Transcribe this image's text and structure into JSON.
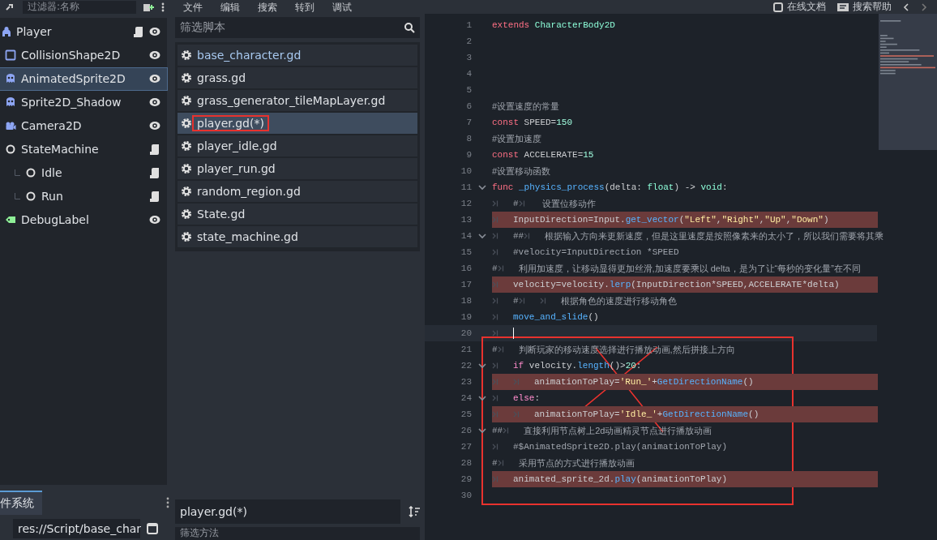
{
  "top_bar": {
    "node_filter_placeholder": "过滤器:名称",
    "menus": [
      "文件",
      "编辑",
      "搜索",
      "转到",
      "调试"
    ],
    "help_buttons": [
      "在线文档",
      "搜索帮助"
    ]
  },
  "scene_tree": {
    "items": [
      {
        "label": "Player",
        "kind": "body",
        "selected": false,
        "has_script": true,
        "has_visibility": true,
        "children": [
          {
            "label": "CollisionShape2D",
            "kind": "shape",
            "selected": false,
            "has_script": false,
            "has_visibility": true
          },
          {
            "label": "AnimatedSprite2D",
            "kind": "sprite",
            "selected": true,
            "has_script": false,
            "has_visibility": true
          },
          {
            "label": "Sprite2D_Shadow",
            "kind": "sprite",
            "selected": false,
            "has_script": false,
            "has_visibility": true
          },
          {
            "label": "Camera2D",
            "kind": "camera",
            "selected": false,
            "has_script": false,
            "has_visibility": true
          },
          {
            "label": "StateMachine",
            "kind": "node",
            "selected": false,
            "has_script": true,
            "has_visibility": false,
            "children": [
              {
                "label": "Idle",
                "kind": "node",
                "selected": false,
                "has_script": true,
                "has_visibility": false
              },
              {
                "label": "Run",
                "kind": "node",
                "selected": false,
                "has_script": true,
                "has_visibility": false
              }
            ]
          },
          {
            "label": "DebugLabel",
            "kind": "label",
            "selected": false,
            "has_script": false,
            "has_visibility": true
          }
        ]
      }
    ]
  },
  "filesystem": {
    "tab": "件系统",
    "path": "res://Script/base_char"
  },
  "script_panel": {
    "filter_placeholder": "筛选脚本",
    "scripts": [
      {
        "name": "base_character.gd",
        "selected": false,
        "outlined": false,
        "color": "#a8c9f0"
      },
      {
        "name": "grass.gd",
        "selected": false,
        "outlined": false,
        "color": "#dfe2e6"
      },
      {
        "name": "grass_generator_tileMapLayer.gd",
        "selected": false,
        "outlined": false,
        "color": "#dfe2e6"
      },
      {
        "name": "player.gd(*)",
        "selected": true,
        "outlined": true,
        "color": "#dfe2e6"
      },
      {
        "name": "player_idle.gd",
        "selected": false,
        "outlined": false,
        "color": "#dfe2e6"
      },
      {
        "name": "player_run.gd",
        "selected": false,
        "outlined": false,
        "color": "#dfe2e6"
      },
      {
        "name": "random_region.gd",
        "selected": false,
        "outlined": false,
        "color": "#dfe2e6"
      },
      {
        "name": "State.gd",
        "selected": false,
        "outlined": false,
        "color": "#dfe2e6"
      },
      {
        "name": "state_machine.gd",
        "selected": false,
        "outlined": false,
        "color": "#dfe2e6"
      }
    ],
    "current_script": "player.gd(*)",
    "method_filter_placeholder": "筛选方法"
  },
  "editor": {
    "lines": [
      {
        "number": "1",
        "tokens": [
          {
            "kind": "keyword",
            "text": "extends "
          },
          {
            "kind": "type",
            "text": "CharacterBody2D"
          }
        ],
        "highlighted": false,
        "foldable": false,
        "current": false
      },
      {
        "number": "2",
        "highlighted": false,
        "foldable": false,
        "current": false
      },
      {
        "number": "3",
        "highlighted": false,
        "foldable": false,
        "current": false
      },
      {
        "number": "4",
        "highlighted": false,
        "foldable": false,
        "current": false
      },
      {
        "number": "5",
        "highlighted": false,
        "foldable": false,
        "current": false
      },
      {
        "number": "6",
        "tokens": [
          {
            "kind": "comment",
            "text": "#设置速度的常量"
          }
        ],
        "highlighted": false,
        "foldable": false,
        "current": false
      },
      {
        "number": "7",
        "tokens": [
          {
            "kind": "keyword",
            "text": "const"
          },
          {
            "kind": "plain",
            "text": " SPEED="
          },
          {
            "kind": "number",
            "text": "150"
          }
        ],
        "highlighted": false,
        "foldable": false,
        "current": false
      },
      {
        "number": "8",
        "tokens": [
          {
            "kind": "comment",
            "text": "#设置加速度"
          }
        ],
        "highlighted": false,
        "foldable": false,
        "current": false
      },
      {
        "number": "9",
        "tokens": [
          {
            "kind": "keyword",
            "text": "const"
          },
          {
            "kind": "plain",
            "text": " ACCELERATE="
          },
          {
            "kind": "number",
            "text": "15"
          }
        ],
        "highlighted": false,
        "foldable": false,
        "current": false
      },
      {
        "number": "10",
        "tokens": [
          {
            "kind": "comment",
            "text": "#设置移动函数"
          }
        ],
        "highlighted": false,
        "foldable": false,
        "current": false
      },
      {
        "number": "11",
        "tokens": [
          {
            "kind": "keyword",
            "text": "func "
          },
          {
            "kind": "function",
            "text": "_physics_process"
          },
          {
            "kind": "plain",
            "text": "(delta: "
          },
          {
            "kind": "type",
            "text": "float"
          },
          {
            "kind": "plain",
            "text": ") -> "
          },
          {
            "kind": "type",
            "text": "void"
          },
          {
            "kind": "plain",
            "text": ":"
          }
        ],
        "highlighted": false,
        "foldable": true,
        "current": false
      },
      {
        "number": "12",
        "tokens": [
          {
            "kind": "comment",
            "text": "\t#\t 设置位移动作"
          }
        ],
        "highlighted": false,
        "foldable": false,
        "current": false
      },
      {
        "number": "13",
        "tokens": [
          {
            "kind": "plain",
            "text": "\tInputDirection=Input."
          },
          {
            "kind": "function",
            "text": "get_vector"
          },
          {
            "kind": "plain",
            "text": "("
          },
          {
            "kind": "string",
            "text": "\"Left\""
          },
          {
            "kind": "plain",
            "text": ","
          },
          {
            "kind": "string",
            "text": "\"Right\""
          },
          {
            "kind": "plain",
            "text": ","
          },
          {
            "kind": "string",
            "text": "\"Up\""
          },
          {
            "kind": "plain",
            "text": ","
          },
          {
            "kind": "string",
            "text": "\"Down\""
          },
          {
            "kind": "plain",
            "text": ")"
          }
        ],
        "highlighted": true,
        "foldable": false,
        "current": false
      },
      {
        "number": "14",
        "tokens": [
          {
            "kind": "comment",
            "text": "\t##\t根据输入方向来更新速度，但是这里速度是按照像素来的太小了，所以我们需要将其乘"
          }
        ],
        "highlighted": false,
        "foldable": true,
        "current": false
      },
      {
        "number": "15",
        "tokens": [
          {
            "kind": "comment",
            "text": "\t#velocity=InputDirection *SPEED"
          }
        ],
        "highlighted": false,
        "foldable": false,
        "current": false
      },
      {
        "number": "16",
        "tokens": [
          {
            "kind": "comment",
            "text": "#\t利用加速度，让移动显得更加丝滑,加速度要乘以 delta，是为了让“每秒的变化量”在不同"
          }
        ],
        "highlighted": false,
        "foldable": false,
        "current": false
      },
      {
        "number": "17",
        "tokens": [
          {
            "kind": "plain",
            "text": "\tvelocity=velocity."
          },
          {
            "kind": "function",
            "text": "lerp"
          },
          {
            "kind": "plain",
            "text": "(InputDirection*SPEED,ACCELERATE*delta)"
          }
        ],
        "highlighted": true,
        "foldable": false,
        "current": false
      },
      {
        "number": "18",
        "tokens": [
          {
            "kind": "comment",
            "text": "\t#\t\t根据角色的速度进行移动角色"
          }
        ],
        "highlighted": false,
        "foldable": false,
        "current": false
      },
      {
        "number": "19",
        "tokens": [
          {
            "kind": "function",
            "text": "\tmove_and_slide"
          },
          {
            "kind": "plain",
            "text": "()"
          }
        ],
        "highlighted": false,
        "foldable": false,
        "current": false
      },
      {
        "number": "20",
        "highlighted": false,
        "foldable": false,
        "current": true
      }
    ],
    "red_box": {
      "crossed": true,
      "lines": [
        {
          "number": "21",
          "tokens": [
            {
              "kind": "comment",
              "text": "#\t判断玩家的移动速度选择进行播放动画,然后拼接上方向"
            }
          ],
          "highlighted": false,
          "foldable": false,
          "current": false
        },
        {
          "number": "22",
          "tokens": [
            {
              "kind": "control",
              "text": "\tif"
            },
            {
              "kind": "plain",
              "text": " velocity."
            },
            {
              "kind": "function",
              "text": "length"
            },
            {
              "kind": "plain",
              "text": "()>"
            },
            {
              "kind": "number",
              "text": "20"
            },
            {
              "kind": "plain",
              "text": ":"
            }
          ],
          "highlighted": false,
          "foldable": true,
          "current": false
        },
        {
          "number": "23",
          "tokens": [
            {
              "kind": "plain",
              "text": "\t\tanimationToPlay="
            },
            {
              "kind": "string",
              "text": "'Run_'"
            },
            {
              "kind": "plain",
              "text": "+"
            },
            {
              "kind": "function",
              "text": "GetDirectionName"
            },
            {
              "kind": "plain",
              "text": "()"
            }
          ],
          "highlighted": true,
          "foldable": false,
          "current": false
        },
        {
          "number": "24",
          "tokens": [
            {
              "kind": "control",
              "text": "\telse"
            },
            {
              "kind": "plain",
              "text": ":"
            }
          ],
          "highlighted": false,
          "foldable": true,
          "current": false
        },
        {
          "number": "25",
          "tokens": [
            {
              "kind": "plain",
              "text": "\t\tanimationToPlay="
            },
            {
              "kind": "string",
              "text": "'Idle_'"
            },
            {
              "kind": "plain",
              "text": "+"
            },
            {
              "kind": "function",
              "text": "GetDirectionName"
            },
            {
              "kind": "plain",
              "text": "()"
            }
          ],
          "highlighted": true,
          "foldable": false,
          "current": false
        },
        {
          "number": "26",
          "tokens": [
            {
              "kind": "comment",
              "text": "##\t直接利用节点树上2d动画精灵节点进行播放动画"
            }
          ],
          "highlighted": false,
          "foldable": true,
          "current": false
        },
        {
          "number": "27",
          "tokens": [
            {
              "kind": "comment",
              "text": "\t#$AnimatedSprite2D.play(animationToPlay)"
            }
          ],
          "highlighted": false,
          "foldable": false,
          "current": false
        },
        {
          "number": "28",
          "tokens": [
            {
              "kind": "comment",
              "text": "#\t采用节点的方式进行播放动画"
            }
          ],
          "highlighted": false,
          "foldable": false,
          "current": false
        },
        {
          "number": "29",
          "tokens": [
            {
              "kind": "plain",
              "text": "\tanimated_sprite_2d."
            },
            {
              "kind": "function",
              "text": "play"
            },
            {
              "kind": "plain",
              "text": "(animationToPlay)"
            }
          ],
          "highlighted": true,
          "foldable": false,
          "current": false
        },
        {
          "number": "30",
          "highlighted": false,
          "foldable": false,
          "current": false
        }
      ]
    }
  }
}
